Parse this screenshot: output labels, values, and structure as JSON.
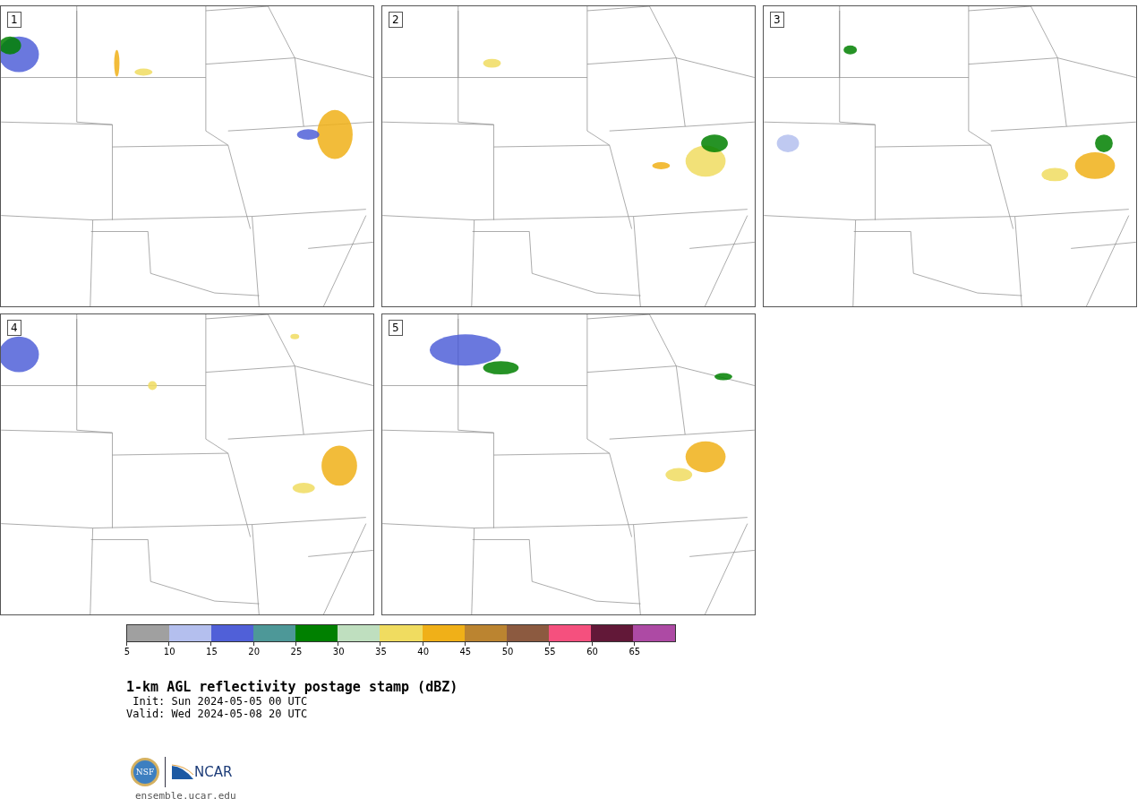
{
  "panels": [
    {
      "number": "1"
    },
    {
      "number": "2"
    },
    {
      "number": "3"
    },
    {
      "number": "4"
    },
    {
      "number": "5"
    }
  ],
  "colorbar": {
    "segments": [
      {
        "color": "#a0a0a0"
      },
      {
        "color": "#b4bfee"
      },
      {
        "color": "#5060d8"
      },
      {
        "color": "#4d9898"
      },
      {
        "color": "#008000"
      },
      {
        "color": "#bfdfbf"
      },
      {
        "color": "#f0dc60"
      },
      {
        "color": "#f0b018"
      },
      {
        "color": "#bb8430"
      },
      {
        "color": "#8c5a40"
      },
      {
        "color": "#f5507e"
      },
      {
        "color": "#621838"
      },
      {
        "color": "#ad4aa4"
      }
    ],
    "ticks": [
      "5",
      "10",
      "15",
      "20",
      "25",
      "30",
      "35",
      "40",
      "45",
      "50",
      "55",
      "60",
      "65"
    ]
  },
  "title": "1-km AGL reflectivity postage stamp (dBZ)",
  "init": " Init: Sun 2024-05-05 00 UTC",
  "valid": "Valid: Wed 2024-05-08 20 UTC",
  "logo": {
    "left": "NSF",
    "right": "NCAR"
  },
  "site": "ensemble.ucar.edu"
}
